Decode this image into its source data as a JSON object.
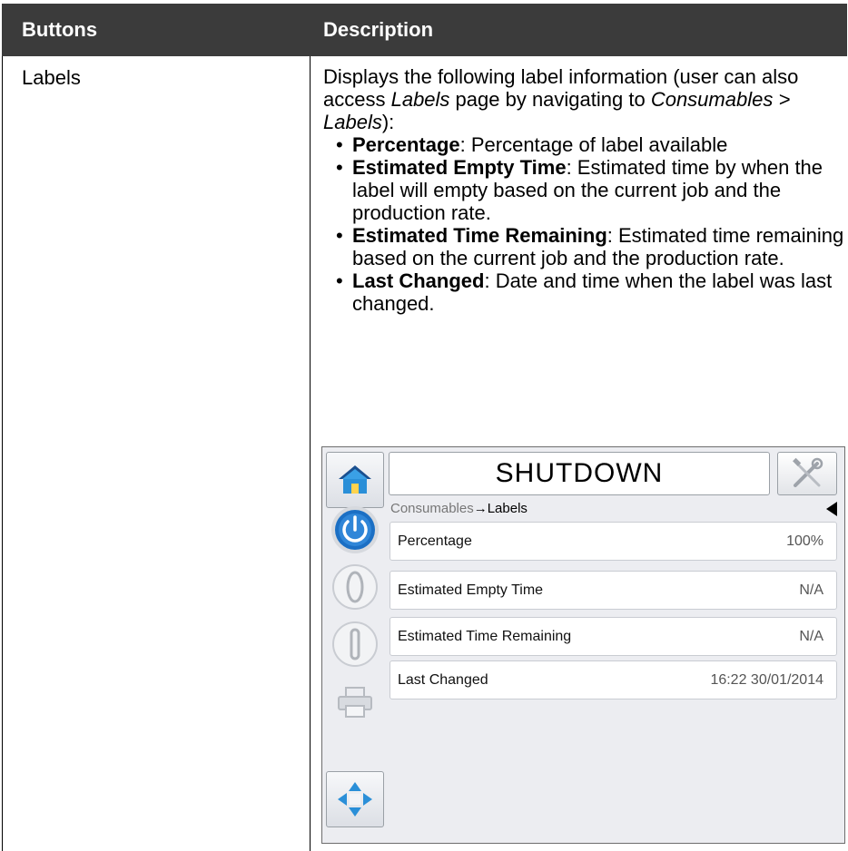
{
  "table": {
    "headers": [
      "Buttons",
      "Description"
    ],
    "button_name": "Labels",
    "description": {
      "intro_pre": "Displays the following label information (user can also access ",
      "intro_labels": "Labels",
      "intro_mid": " page by navigating to ",
      "intro_path": "Consumables > Labels",
      "intro_post": "):",
      "bullets": [
        {
          "term": "Percentage",
          "text": ": Percentage of label available"
        },
        {
          "term": "Estimated Empty Time",
          "text": ": Estimated time by when the label will empty based on the current job and the production rate."
        },
        {
          "term": "Estimated Time Remaining",
          "text": ": Estimated time remaining based on the current job and the production rate."
        },
        {
          "term": "Last Changed",
          "text": ": Date and time when the label was last changed."
        }
      ]
    }
  },
  "screen": {
    "status_title": "SHUTDOWN",
    "breadcrumb": {
      "parent": "Consumables",
      "arrow": "→",
      "current": "Labels"
    },
    "rows": [
      {
        "label": "Percentage",
        "value": "100%"
      },
      {
        "label": "Estimated Empty Time",
        "value": "N/A"
      },
      {
        "label": "Estimated Time Remaining",
        "value": "N/A"
      },
      {
        "label": "Last Changed",
        "value": "16:22 30/01/2014"
      }
    ],
    "side_icons": [
      "home-icon",
      "power-icon",
      "stop-icon",
      "start-icon",
      "printer-icon",
      "navigate-icon"
    ],
    "colors": {
      "header_bg": "#3b3b3b",
      "power_blue": "#1b6fc4",
      "home_blue": "#2a8fd8",
      "home_roof": "#1a4f8f"
    }
  }
}
